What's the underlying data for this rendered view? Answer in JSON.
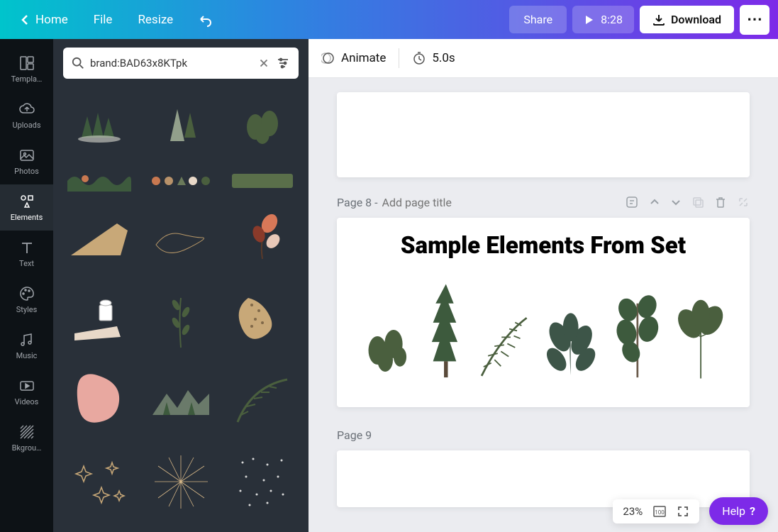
{
  "topbar": {
    "home": "Home",
    "file": "File",
    "resize": "Resize",
    "share": "Share",
    "play_time": "8:28",
    "download": "Download"
  },
  "sidebar": {
    "items": [
      {
        "label": "Templa…"
      },
      {
        "label": "Uploads"
      },
      {
        "label": "Photos"
      },
      {
        "label": "Elements"
      },
      {
        "label": "Text"
      },
      {
        "label": "Styles"
      },
      {
        "label": "Music"
      },
      {
        "label": "Videos"
      },
      {
        "label": "Bkgrou…"
      }
    ]
  },
  "search": {
    "value": "brand:BAD63x8KTpk"
  },
  "context": {
    "animate": "Animate",
    "duration": "5.0s"
  },
  "pages": {
    "p8_label": "Page 8 -",
    "p8_title_placeholder": "Add page title",
    "p8_heading": "Sample Elements From Set",
    "p9_label": "Page 9"
  },
  "footer": {
    "zoom": "23%",
    "help": "Help"
  },
  "elements_panel": {
    "items": [
      "forest-trees",
      "snow-pines",
      "cactus",
      "tropical-border",
      "color-palette",
      "green-swatch",
      "sand-hill",
      "gold-cloud",
      "abstract-leaves",
      "book-coffee",
      "branch",
      "leopard-map",
      "pink-blob",
      "mountain-scene",
      "palm-leaf",
      "gold-stars",
      "gold-burst",
      "white-dots"
    ]
  }
}
